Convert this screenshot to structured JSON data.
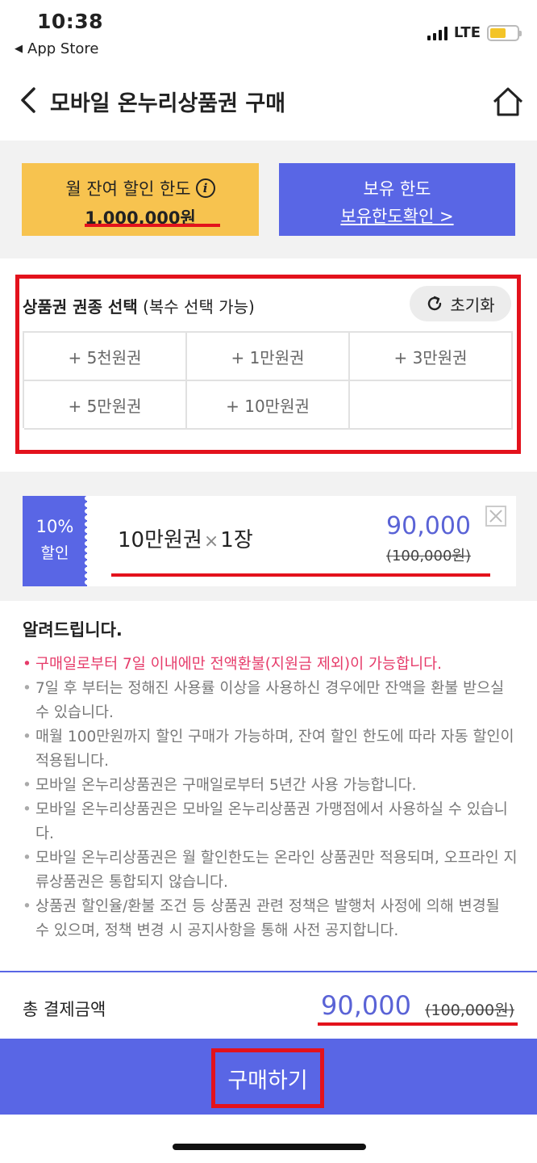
{
  "status_bar": {
    "time": "10:38",
    "back_app": "App Store",
    "network": "LTE",
    "battery_level": 0.6
  },
  "header": {
    "title": "모바일 온누리상품권 구매",
    "back_icon": "chevron-left-icon",
    "home_icon": "home-icon"
  },
  "limits": {
    "monthly_title": "월 잔여 할인 한도",
    "monthly_value": "1,000,000원",
    "hold_title": "보유 한도",
    "hold_link": "보유한도확인 >"
  },
  "selection": {
    "title_bold": "상품권 권종 선택",
    "title_note": "(복수 선택 가능)",
    "reset_label": "초기화",
    "options": [
      "+ 5천원권",
      "+ 1만원권",
      "+ 3만원권",
      "+ 5만원권",
      "+ 10만원권"
    ]
  },
  "selected": {
    "discount_percent": "10%",
    "discount_label": "할인",
    "item_name": "10만원권",
    "times": "×",
    "quantity": "1장",
    "price": "90,000",
    "original_price": "(100,000원)"
  },
  "notice": {
    "title": "알려드립니다.",
    "items": [
      "구매일로부터 7일 이내에만 전액환불(지원금 제외)이 가능합니다.",
      "7일 후 부터는 정해진 사용률 이상을 사용하신 경우에만 잔액을 환불 받으실 수 있습니다.",
      "매월 100만원까지 할인 구매가 가능하며, 잔여 할인 한도에 따라 자동 할인이 적용됩니다.",
      "모바일 온누리상품권은 구매일로부터 5년간 사용 가능합니다.",
      "모바일 온누리상품권은 모바일 온누리상품권 가맹점에서 사용하실 수 있습니다.",
      "모바일 온누리상품권은 월 할인한도는 온라인 상품권만 적용되며, 오프라인 지류상품권은 통합되지 않습니다.",
      "상품권 할인율/환불 조건 등 상품권 관련 정책은 발행처 사정에 의해 변경될 수 있으며, 정책 변경 시 공지사항을 통해 사전 공지합니다."
    ]
  },
  "total": {
    "label": "총 결제금액",
    "price": "90,000",
    "original_price": "(100,000원)"
  },
  "buy": {
    "label": "구매하기"
  },
  "colors": {
    "primary": "#5966e5",
    "accent_yellow": "#f7c34f",
    "highlight_red": "#e3121c",
    "notice_pink": "#e63b6a"
  }
}
